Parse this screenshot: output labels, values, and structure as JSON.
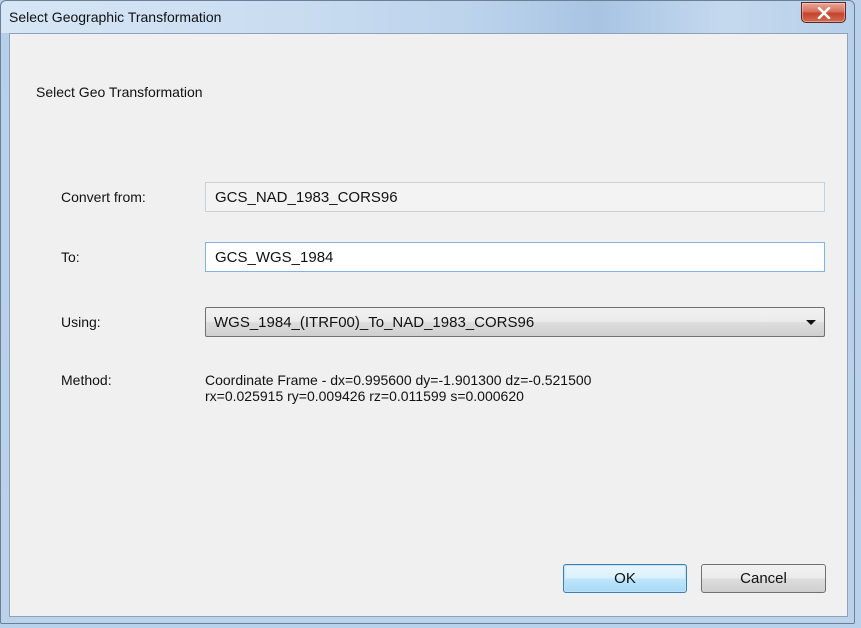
{
  "window": {
    "title": "Select Geographic Transformation"
  },
  "caption": "Select Geo Transformation",
  "form": {
    "convert_from": {
      "label": "Convert from:",
      "value": "GCS_NAD_1983_CORS96"
    },
    "to": {
      "label": "To:",
      "value": "GCS_WGS_1984"
    },
    "using": {
      "label": "Using:",
      "selected": "WGS_1984_(ITRF00)_To_NAD_1983_CORS96"
    },
    "method": {
      "label": "Method:",
      "line1": "Coordinate Frame - dx=0.995600 dy=-1.901300 dz=-0.521500",
      "line2": "rx=0.025915 ry=0.009426 rz=0.011599 s=0.000620"
    }
  },
  "buttons": {
    "ok": "OK",
    "cancel": "Cancel"
  },
  "icons": {
    "close": "close-icon",
    "dropdown": "chevron-down-icon"
  },
  "colors": {
    "accent_border": "#3c7fb1",
    "close_button": "#c5432c"
  }
}
